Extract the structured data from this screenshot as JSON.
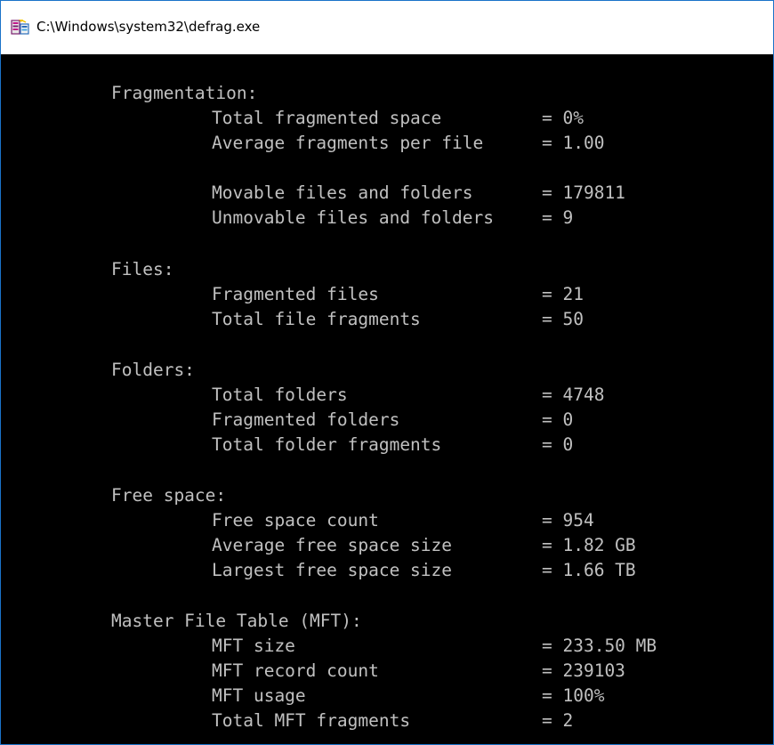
{
  "window": {
    "title": "C:\\Windows\\system32\\defrag.exe",
    "icon": "defrag-icon"
  },
  "console": {
    "sections": [
      {
        "header": "Fragmentation:",
        "rows": [
          {
            "label": "Total fragmented space",
            "value": "= 0%"
          },
          {
            "label": "Average fragments per file",
            "value": "= 1.00"
          },
          {
            "label": "Movable files and folders",
            "value": "= 179811"
          },
          {
            "label": "Unmovable files and folders",
            "value": "= 9"
          }
        ]
      },
      {
        "header": "Files:",
        "rows": [
          {
            "label": "Fragmented files",
            "value": "= 21"
          },
          {
            "label": "Total file fragments",
            "value": "= 50"
          }
        ]
      },
      {
        "header": "Folders:",
        "rows": [
          {
            "label": "Total folders",
            "value": "= 4748"
          },
          {
            "label": "Fragmented folders",
            "value": "= 0"
          },
          {
            "label": "Total folder fragments",
            "value": "= 0"
          }
        ]
      },
      {
        "header": "Free space:",
        "rows": [
          {
            "label": "Free space count",
            "value": "= 954"
          },
          {
            "label": "Average free space size",
            "value": "= 1.82 GB"
          },
          {
            "label": "Largest free space size",
            "value": "= 1.66 TB"
          }
        ]
      },
      {
        "header": "Master File Table (MFT):",
        "rows": [
          {
            "label": "MFT size",
            "value": "= 233.50 MB"
          },
          {
            "label": "MFT record count",
            "value": "= 239103"
          },
          {
            "label": "MFT usage",
            "value": "= 100%"
          },
          {
            "label": "Total MFT fragments",
            "value": "= 2"
          }
        ]
      }
    ]
  }
}
